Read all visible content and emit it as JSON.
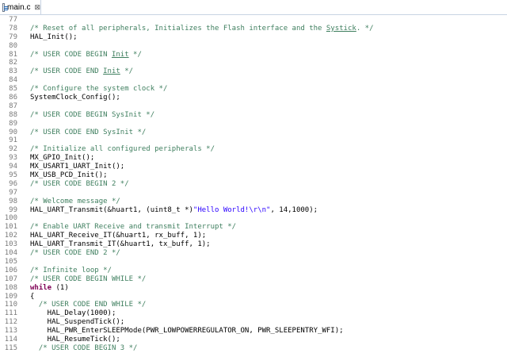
{
  "tab": {
    "filename": "main.c",
    "close_glyph": "⊠"
  },
  "lines": [
    {
      "n": "77",
      "tokens": []
    },
    {
      "n": "78",
      "tokens": [
        [
          "comment",
          "/* Reset of all peripherals, Initializes the Flash interface and the "
        ],
        [
          "comment-u",
          "Systick"
        ],
        [
          "comment",
          ". */"
        ]
      ]
    },
    {
      "n": "79",
      "tokens": [
        [
          "plain",
          "HAL_Init();"
        ]
      ]
    },
    {
      "n": "80",
      "tokens": []
    },
    {
      "n": "81",
      "tokens": [
        [
          "comment",
          "/* USER CODE BEGIN "
        ],
        [
          "comment-u",
          "Init"
        ],
        [
          "comment",
          " */"
        ]
      ]
    },
    {
      "n": "82",
      "tokens": []
    },
    {
      "n": "83",
      "tokens": [
        [
          "comment",
          "/* USER CODE END "
        ],
        [
          "comment-u",
          "Init"
        ],
        [
          "comment",
          " */"
        ]
      ]
    },
    {
      "n": "84",
      "tokens": []
    },
    {
      "n": "85",
      "tokens": [
        [
          "comment",
          "/* Configure the system clock */"
        ]
      ]
    },
    {
      "n": "86",
      "tokens": [
        [
          "plain",
          "SystemClock_Config();"
        ]
      ]
    },
    {
      "n": "87",
      "tokens": []
    },
    {
      "n": "88",
      "tokens": [
        [
          "comment",
          "/* USER CODE BEGIN SysInit */"
        ]
      ]
    },
    {
      "n": "89",
      "tokens": []
    },
    {
      "n": "90",
      "tokens": [
        [
          "comment",
          "/* USER CODE END SysInit */"
        ]
      ]
    },
    {
      "n": "91",
      "tokens": []
    },
    {
      "n": "92",
      "tokens": [
        [
          "comment",
          "/* Initialize all configured peripherals */"
        ]
      ]
    },
    {
      "n": "93",
      "tokens": [
        [
          "plain",
          "MX_GPIO_Init();"
        ]
      ]
    },
    {
      "n": "94",
      "tokens": [
        [
          "plain",
          "MX_USART1_UART_Init();"
        ]
      ]
    },
    {
      "n": "95",
      "tokens": [
        [
          "plain",
          "MX_USB_PCD_Init();"
        ]
      ]
    },
    {
      "n": "96",
      "tokens": [
        [
          "comment",
          "/* USER CODE BEGIN 2 */"
        ]
      ]
    },
    {
      "n": "97",
      "tokens": []
    },
    {
      "n": "98",
      "tokens": [
        [
          "comment",
          "/* Welcome message */"
        ]
      ]
    },
    {
      "n": "99",
      "tokens": [
        [
          "plain",
          "HAL_UART_Transmit(&huart1, (uint8_t *)"
        ],
        [
          "string",
          "\"Hello World!\\r\\n\""
        ],
        [
          "plain",
          ", 14,1000);"
        ]
      ]
    },
    {
      "n": "100",
      "tokens": []
    },
    {
      "n": "101",
      "tokens": [
        [
          "comment",
          "/* Enable UART Receive and transmit Interrupt */"
        ]
      ]
    },
    {
      "n": "102",
      "tokens": [
        [
          "plain",
          "HAL_UART_Receive_IT(&huart1, rx_buff, 1);"
        ]
      ]
    },
    {
      "n": "103",
      "tokens": [
        [
          "plain",
          "HAL_UART_Transmit_IT(&huart1, tx_buff, 1);"
        ]
      ]
    },
    {
      "n": "104",
      "tokens": [
        [
          "comment",
          "/* USER CODE END 2 */"
        ]
      ]
    },
    {
      "n": "105",
      "tokens": []
    },
    {
      "n": "106",
      "tokens": [
        [
          "comment",
          "/* Infinite loop */"
        ]
      ]
    },
    {
      "n": "107",
      "tokens": [
        [
          "comment",
          "/* USER CODE BEGIN WHILE */"
        ]
      ]
    },
    {
      "n": "108",
      "tokens": [
        [
          "keyword",
          "while"
        ],
        [
          "plain",
          " (1)"
        ]
      ]
    },
    {
      "n": "109",
      "tokens": [
        [
          "plain",
          "{"
        ]
      ]
    },
    {
      "n": "110",
      "tokens": [
        [
          "comment",
          "  /* USER CODE END WHILE */"
        ]
      ]
    },
    {
      "n": "111",
      "tokens": [
        [
          "plain",
          "    HAL_Delay(1000);"
        ]
      ]
    },
    {
      "n": "112",
      "tokens": [
        [
          "plain",
          "    HAL_SuspendTick();"
        ]
      ]
    },
    {
      "n": "113",
      "tokens": [
        [
          "plain",
          "    HAL_PWR_EnterSLEEPMode(PWR_LOWPOWERREGULATOR_ON, PWR_SLEEPENTRY_WFI);"
        ]
      ]
    },
    {
      "n": "114",
      "tokens": [
        [
          "plain",
          "    HAL_ResumeTick();"
        ]
      ]
    },
    {
      "n": "115",
      "tokens": [
        [
          "comment",
          "  /* USER CODE BEGIN 3 */"
        ]
      ]
    }
  ],
  "colors": {
    "comment": "#3f7f5f",
    "keyword": "#7f0055",
    "string": "#2a00ff",
    "line_number": "#7a7a7a"
  }
}
